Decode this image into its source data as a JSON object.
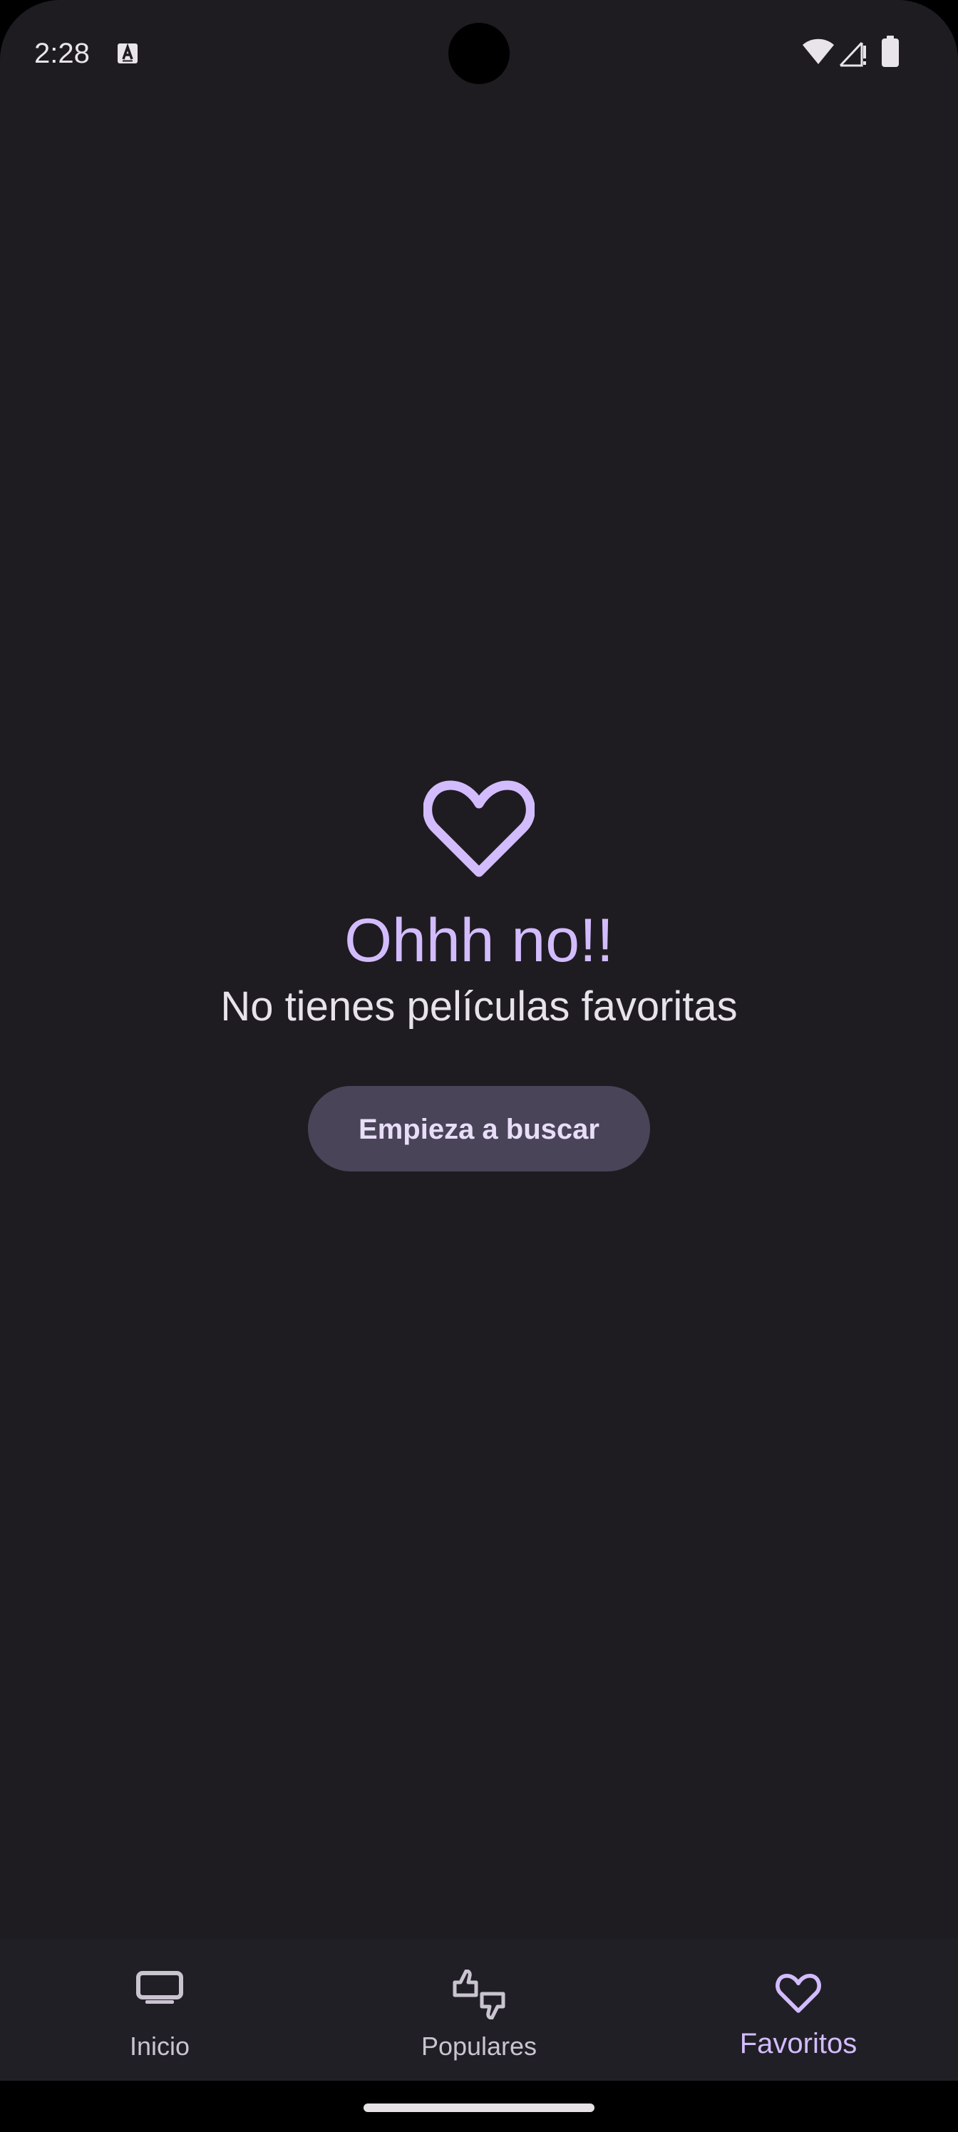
{
  "status_bar": {
    "time": "2:28"
  },
  "empty_state": {
    "icon": "heart-outline-icon",
    "title": "Ohhh no!!",
    "subtitle": "No tienes películas favoritas",
    "button_label": "Empieza a buscar"
  },
  "bottom_nav": {
    "items": [
      {
        "label": "Inicio",
        "icon": "tv-icon",
        "active": false
      },
      {
        "label": "Populares",
        "icon": "thumbs-up-down-icon",
        "active": false
      },
      {
        "label": "Favoritos",
        "icon": "heart-outline-icon",
        "active": true
      }
    ]
  },
  "colors": {
    "background": "#1e1c21",
    "accent": "#d3bcfd",
    "button_bg": "#4a4458",
    "nav_bg": "#211f26",
    "text": "#e8e2ea"
  }
}
